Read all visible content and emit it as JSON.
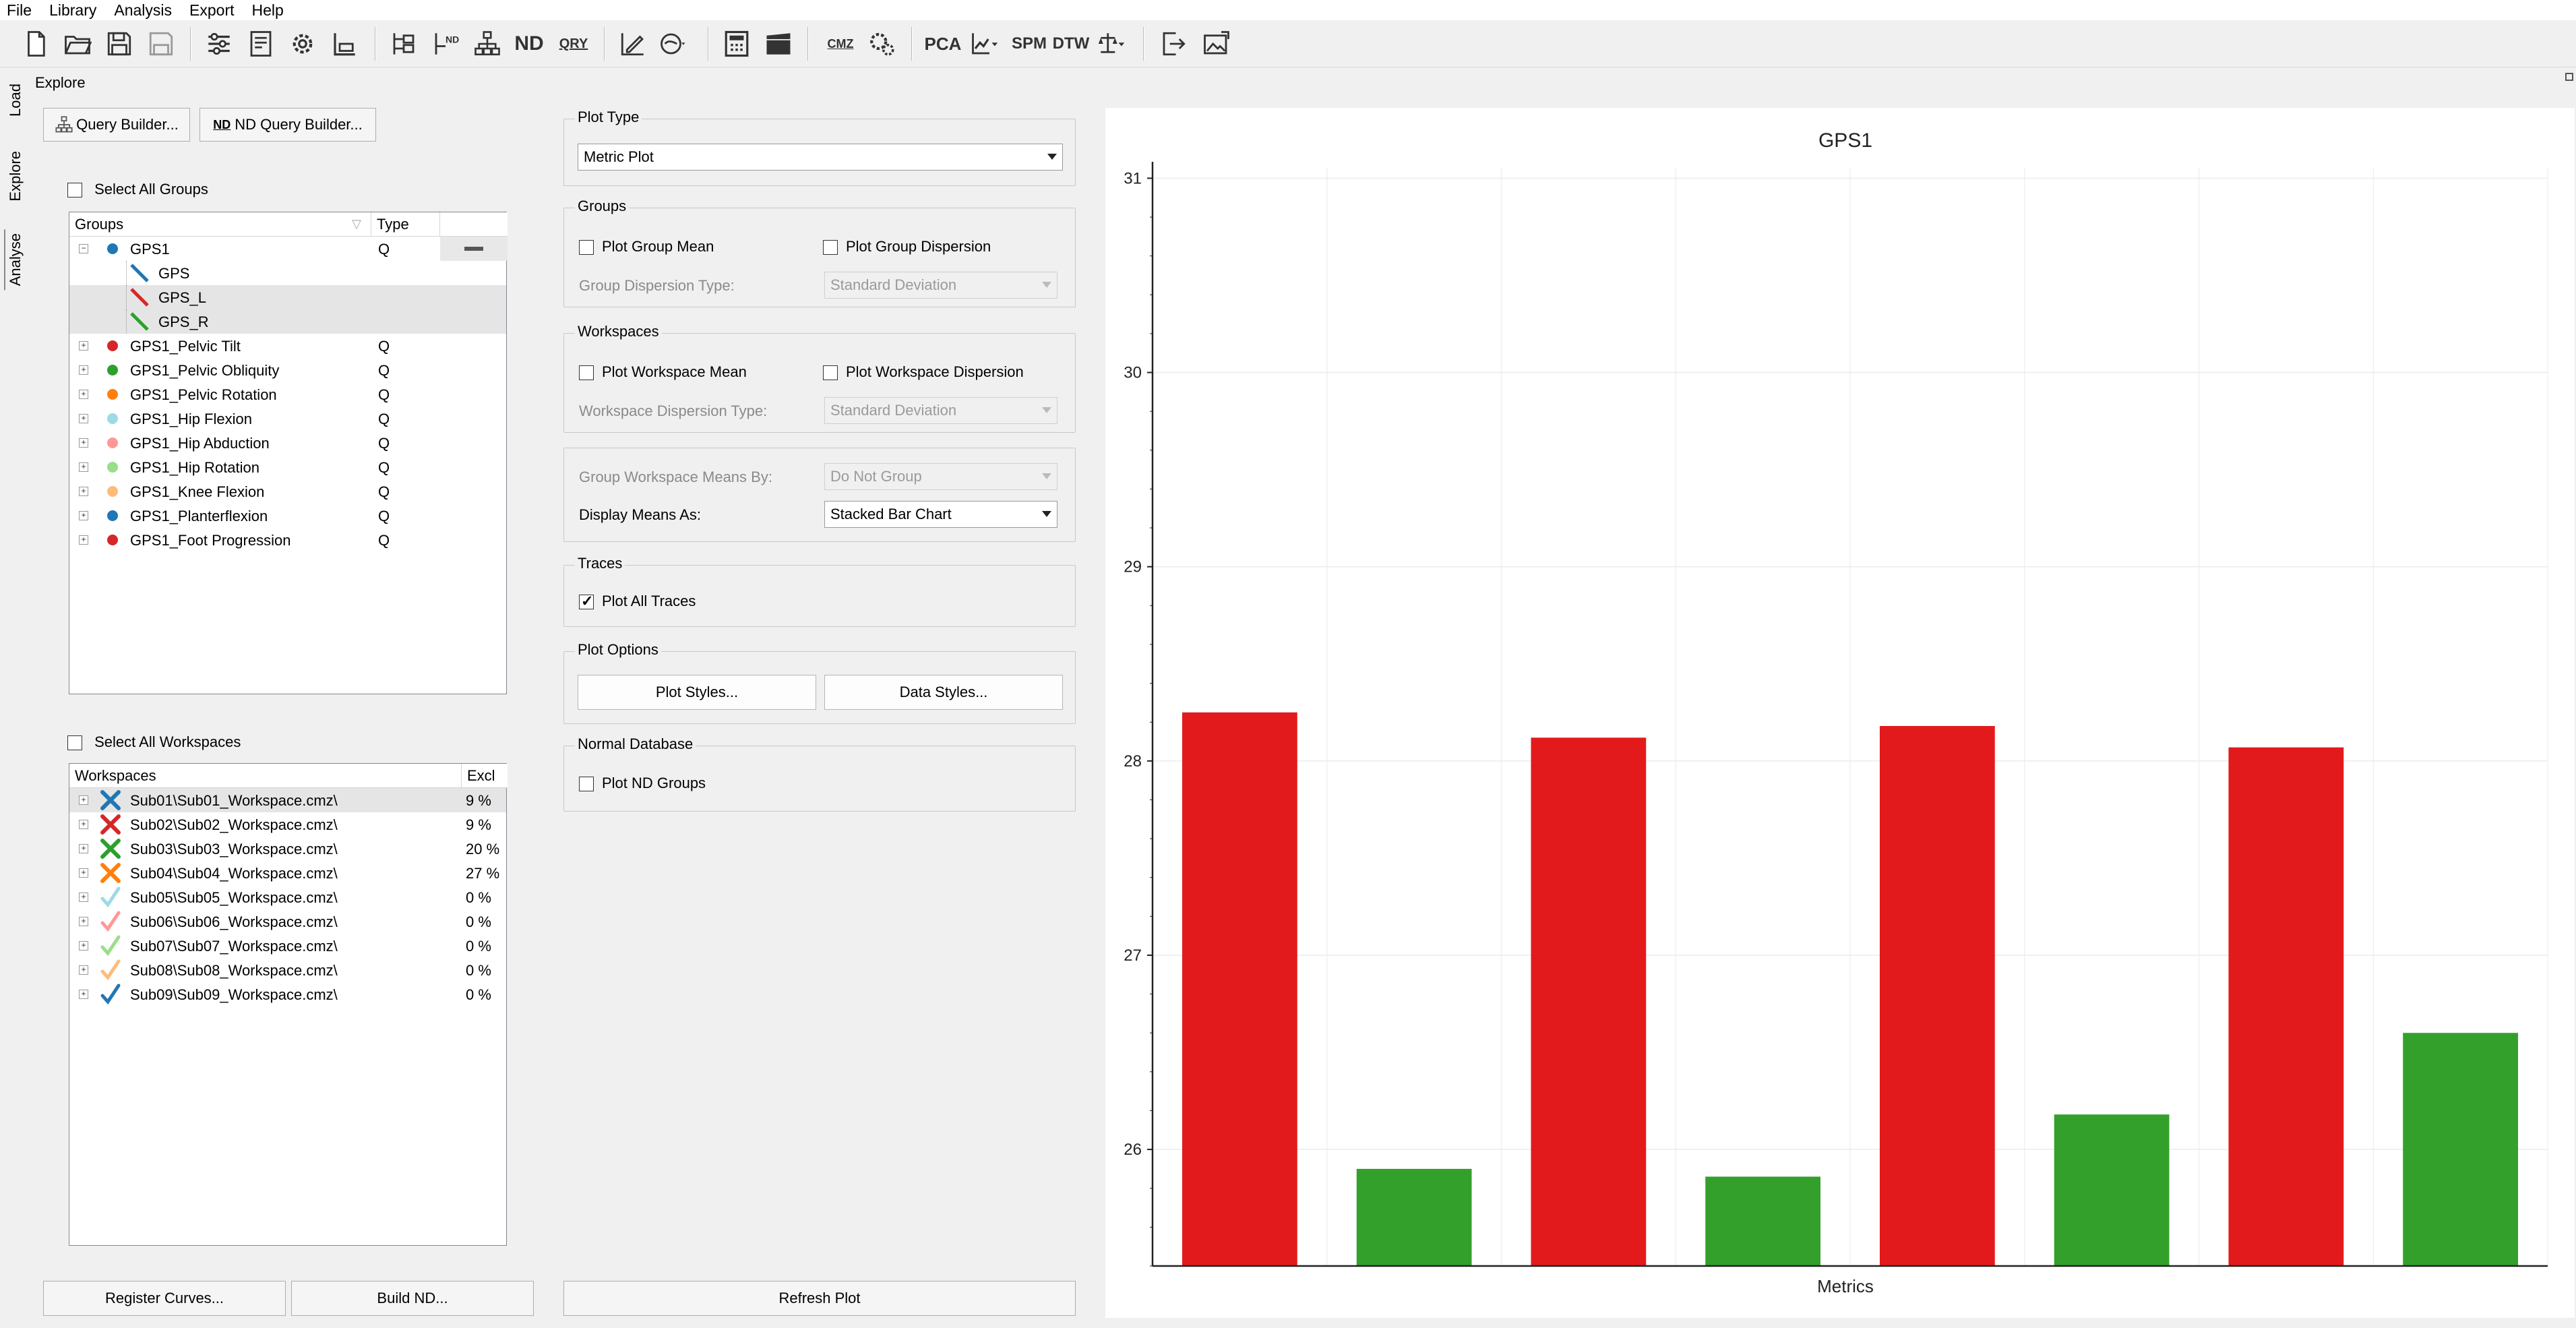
{
  "menu": [
    "File",
    "Library",
    "Analysis",
    "Export",
    "Help"
  ],
  "toolbar": {
    "pca": "PCA",
    "spm": "SPM",
    "dtw": "DTW",
    "nd": "ND",
    "qry": "QRY",
    "cmz": "CMZ"
  },
  "side_tabs": [
    "Load",
    "Explore",
    "Analyse"
  ],
  "panel_title": "Explore",
  "buttons": {
    "query_builder": "Query Builder...",
    "nd_query_builder": "ND Query Builder...",
    "register_curves": "Register Curves...",
    "build_nd": "Build ND...",
    "refresh_plot": "Refresh Plot",
    "plot_styles": "Plot Styles...",
    "data_styles": "Data Styles..."
  },
  "groups_panel": {
    "select_all": "Select All Groups",
    "col_groups": "Groups",
    "col_type": "Type",
    "root": {
      "name": "GPS1",
      "type": "Q",
      "color": "#1f77b4",
      "children": [
        {
          "name": "GPS",
          "color": "#1f77b4"
        },
        {
          "name": "GPS_L",
          "color": "#d62728"
        },
        {
          "name": "GPS_R",
          "color": "#2ca02c"
        }
      ]
    },
    "items": [
      {
        "name": "GPS1_Pelvic Tilt",
        "type": "Q",
        "color": "#d62728"
      },
      {
        "name": "GPS1_Pelvic Obliquity",
        "type": "Q",
        "color": "#2ca02c"
      },
      {
        "name": "GPS1_Pelvic Rotation",
        "type": "Q",
        "color": "#ff7f0e"
      },
      {
        "name": "GPS1_Hip Flexion",
        "type": "Q",
        "color": "#9edae5"
      },
      {
        "name": "GPS1_Hip Abduction",
        "type": "Q",
        "color": "#ff9896"
      },
      {
        "name": "GPS1_Hip Rotation",
        "type": "Q",
        "color": "#98df8a"
      },
      {
        "name": "GPS1_Knee Flexion",
        "type": "Q",
        "color": "#ffbb78"
      },
      {
        "name": "GPS1_Planterflexion",
        "type": "Q",
        "color": "#1f77b4"
      },
      {
        "name": "GPS1_Foot Progression",
        "type": "Q",
        "color": "#d62728"
      }
    ]
  },
  "workspaces_panel": {
    "select_all": "Select All Workspaces",
    "col_workspaces": "Workspaces",
    "col_excl": "Excl",
    "items": [
      {
        "name": "Sub01\\Sub01_Workspace.cmz\\",
        "excl": "9 %",
        "mark": "x",
        "color": "#1f77b4"
      },
      {
        "name": "Sub02\\Sub02_Workspace.cmz\\",
        "excl": "9 %",
        "mark": "x",
        "color": "#d62728"
      },
      {
        "name": "Sub03\\Sub03_Workspace.cmz\\",
        "excl": "20 %",
        "mark": "x",
        "color": "#2ca02c"
      },
      {
        "name": "Sub04\\Sub04_Workspace.cmz\\",
        "excl": "27 %",
        "mark": "x",
        "color": "#ff7f0e"
      },
      {
        "name": "Sub05\\Sub05_Workspace.cmz\\",
        "excl": "0 %",
        "mark": "check",
        "color": "#9edae5"
      },
      {
        "name": "Sub06\\Sub06_Workspace.cmz\\",
        "excl": "0 %",
        "mark": "check",
        "color": "#ff9896"
      },
      {
        "name": "Sub07\\Sub07_Workspace.cmz\\",
        "excl": "0 %",
        "mark": "check",
        "color": "#98df8a"
      },
      {
        "name": "Sub08\\Sub08_Workspace.cmz\\",
        "excl": "0 %",
        "mark": "check",
        "color": "#ffbb78"
      },
      {
        "name": "Sub09\\Sub09_Workspace.cmz\\",
        "excl": "0 %",
        "mark": "check",
        "color": "#1f77b4"
      }
    ]
  },
  "options": {
    "plot_type": {
      "title": "Plot Type",
      "value": "Metric Plot"
    },
    "groups": {
      "title": "Groups",
      "mean": "Plot Group Mean",
      "dispersion": "Plot Group Dispersion",
      "disp_type_label": "Group Dispersion Type:",
      "disp_type_value": "Standard Deviation"
    },
    "workspaces": {
      "title": "Workspaces",
      "mean": "Plot Workspace Mean",
      "dispersion": "Plot Workspace Dispersion",
      "disp_type_label": "Workspace Dispersion Type:",
      "disp_type_value": "Standard Deviation"
    },
    "means": {
      "by_label": "Group Workspace Means By:",
      "by_value": "Do Not Group",
      "display_label": "Display Means As:",
      "display_value": "Stacked Bar Chart"
    },
    "traces": {
      "title": "Traces",
      "plot_all": "Plot All Traces",
      "plot_all_checked": true
    },
    "plot_options": {
      "title": "Plot Options"
    },
    "normal_db": {
      "title": "Normal Database",
      "plot_nd": "Plot ND Groups"
    }
  },
  "chart_data": {
    "type": "bar",
    "title": "GPS1",
    "xlabel": "Metrics",
    "ylabel": "",
    "ylim": [
      25.4,
      31.05
    ],
    "yticks": [
      26,
      27,
      28,
      29,
      30,
      31
    ],
    "grid": true,
    "values": [
      28.25,
      25.9,
      28.12,
      25.86,
      28.18,
      26.18,
      28.07,
      26.6
    ],
    "colors": [
      "#e31a1c",
      "#33a02c",
      "#e31a1c",
      "#33a02c",
      "#e31a1c",
      "#33a02c",
      "#e31a1c",
      "#33a02c"
    ]
  }
}
